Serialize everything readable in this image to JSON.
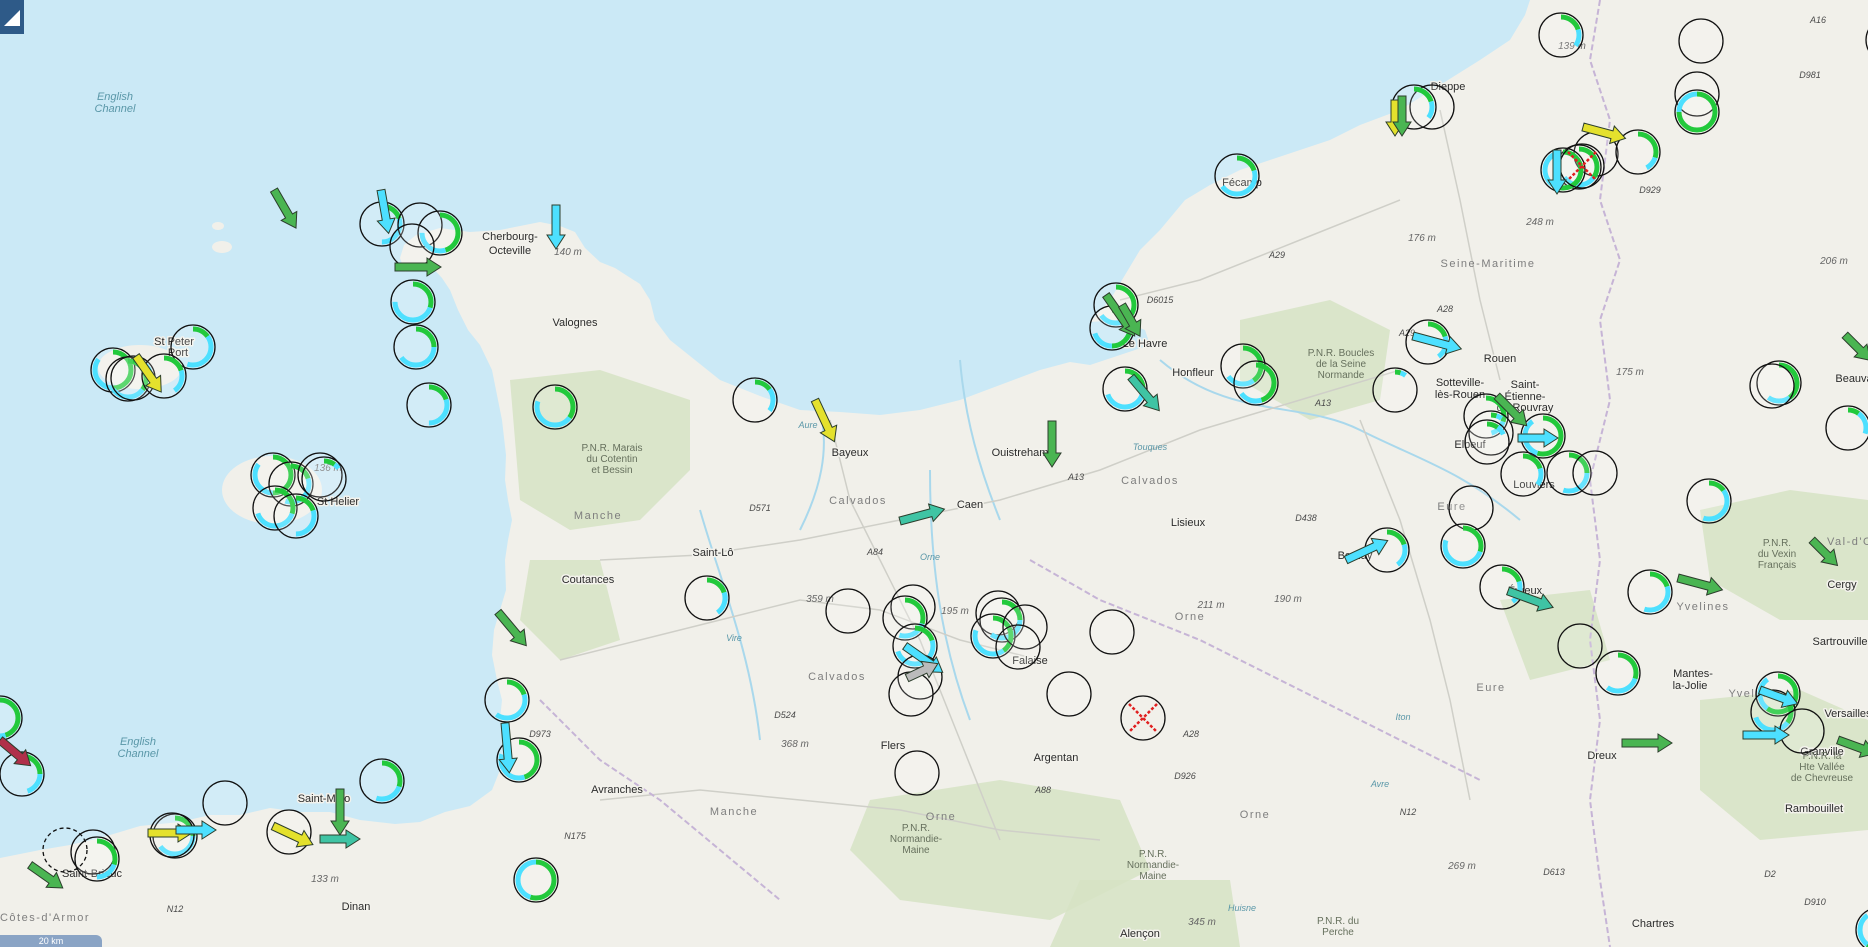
{
  "map": {
    "sea_labels": [
      {
        "id": "sea-1",
        "lines": [
          "English",
          "Channel"
        ]
      },
      {
        "id": "sea-2",
        "lines": [
          "English",
          "Channel"
        ]
      }
    ],
    "cities": [
      "Cherbourg-",
      "Octeville",
      "Valognes",
      "St Peter",
      "Port",
      "St Helier",
      "Coutances",
      "Saint-Lô",
      "Bayeux",
      "Caen",
      "Ouistreham",
      "Le Havre",
      "Honfleur",
      "Fécamp",
      "Dieppe",
      "Rouen",
      "Sotteville-",
      "lès-Rouen",
      "Saint-",
      "Étienne-",
      "du-Rouvray",
      "Elbeuf",
      "Louviers",
      "Évreux",
      "Bernay",
      "Lisieux",
      "Falaise",
      "Argentan",
      "Flers",
      "Avranches",
      "Saint-Malo",
      "Saint-Brieuc",
      "Dinan",
      "Alençon",
      "Dreux",
      "Chartres",
      "Mantes-",
      "la-Jolie",
      "Rambouillet",
      "Versailles",
      "Cergy",
      "Sartrouville",
      "Beauvais",
      "Granville"
    ],
    "regions": [
      "Manche",
      "Calvados",
      "Calvados",
      "Calvados",
      "Seine-Maritime",
      "Eure",
      "Eure",
      "Orne",
      "Orne",
      "Orne",
      "Manche",
      "Yvelines",
      "Yvelines",
      "Côtes-d'Armor",
      "Val-d'O"
    ],
    "parks": [
      [
        "P.N.R. Marais",
        "du Cotentin",
        "et Bessin"
      ],
      [
        "P.N.R. Boucles",
        "de la Seine",
        "Normande"
      ],
      [
        "P.N.R.",
        "Normandie-",
        "Maine"
      ],
      [
        "P.N.R.",
        "Normandie-",
        "Maine"
      ],
      [
        "P.N.R.",
        "du Vexin",
        "Français"
      ],
      [
        "P.N.R. la",
        "Hte Vallée",
        "de Chevreuse"
      ],
      [
        "P.N.R. du",
        "Perche"
      ]
    ],
    "roads": [
      "A29",
      "A29",
      "A13",
      "A13",
      "A84",
      "A28",
      "A28",
      "A88",
      "A16",
      "N12",
      "N12",
      "N175",
      "D571",
      "D6015",
      "D929",
      "D973",
      "D524",
      "D926",
      "D438",
      "D613",
      "D981",
      "D910",
      "D2"
    ],
    "elevations": [
      "140 m",
      "139 m",
      "136 m",
      "359 m",
      "195 m",
      "368 m",
      "211 m",
      "190 m",
      "176 m",
      "175 m",
      "248 m",
      "206 m",
      "269 m",
      "133 m",
      "345 m"
    ],
    "rivers": [
      "Aure",
      "Orne",
      "Vire",
      "Touques",
      "Iton",
      "Avre",
      "Huisne"
    ],
    "scale_label": "20 km"
  },
  "colors": {
    "sea": "#cbe9f6",
    "land": "#f1f0ea",
    "forest": "#d6e3c4",
    "marker_green": "#22c93c",
    "marker_cyan": "#4de0ff",
    "arrow_green": "#4ab552",
    "arrow_teal": "#3fc4a4",
    "arrow_yellow": "#e4e12d",
    "cross_red": "#e02020"
  },
  "icons": {
    "station": "circle-ring-marker",
    "wind_arrow": "wind-direction-arrow",
    "no_data": "red-x-cross-marker",
    "toggle": "panel-toggle-triangle"
  }
}
